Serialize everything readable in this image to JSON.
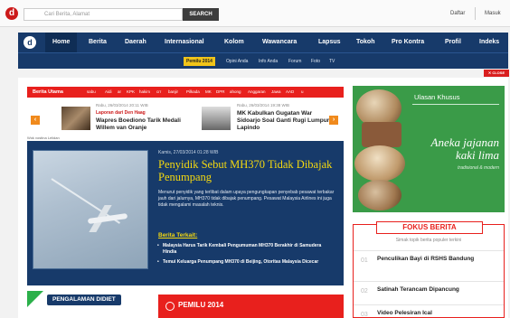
{
  "topbar": {
    "logo_letter": "d",
    "search_placeholder": "Cari Berita, Alamat",
    "search_button": "SEARCH",
    "daftar": "Daftar",
    "masuk": "Masuk"
  },
  "nav": {
    "logo_letter": "d",
    "items": [
      "Home",
      "Berita",
      "Daerah",
      "Internasional",
      "Kolom",
      "Wawancara",
      "Lapsus",
      "Tokoh",
      "Pro Kontra",
      "Profil",
      "Indeks"
    ]
  },
  "subnav": {
    "items": [
      "Pemilu 2014",
      "Opini Anda",
      "Info Anda",
      "Forum",
      "Foto",
      "TV"
    ]
  },
  "close_ad": "✕ CLOSE",
  "berita_utama": {
    "label": "Berita Utama",
    "tags": [
      "sabu",
      "Aidi",
      "ar",
      "KPK",
      "hakim",
      "crr",
      "banjir",
      "Pilkada",
      "MK",
      "DPR",
      "ahong",
      "Anggaran",
      "Jawa",
      "AAD",
      "u"
    ]
  },
  "carousel": {
    "items": [
      {
        "date": "Rabu, 26/03/2014 20:11 WIB",
        "category": "Laporan dari Den Haag",
        "title": "Wapres Boediono Tarik Medali Willem van Oranje"
      },
      {
        "date": "Rabu, 26/03/2014 19:38 WIB",
        "category": "",
        "title": "MK Kabulkan Gugatan War Sidoarjo Soal Ganti Rugi Lumpur Lapindo"
      }
    ],
    "cut_text": "Wok vostina Lelidan"
  },
  "featured": {
    "date": "Kamis, 27/03/2014 01:28 WIB",
    "title": "Penyidik Sebut MH370 Tidak Dibajak Penumpang",
    "body": "Menurut penyidik yang terlibat dalam upaya pengungkapan penyebab pesawat terbakar jauh dari jalurnya, MH370 tidak dibajak penumpang. Pesawat Malaysia Airlines ini juga tidak mengalami masalah teknis.",
    "related_label": "Berita Terkait:",
    "related": [
      "Malaysia Harus Tarik Kembali Pengumuman MH370 Berakhir di Samudera Hindia",
      "Temui Keluarga Penumpang MH370 di Beijing, Otoritas Malaysia Dicecar"
    ]
  },
  "pengalaman": {
    "label": "PENGALAMAN DIDIET"
  },
  "pemilu": {
    "label": "PEMILU 2014"
  },
  "ad": {
    "title": "Ulasan Khusus",
    "headline": "Aneka jajanan kaki lima",
    "sub": "tradisional & modern"
  },
  "fokus": {
    "title": "FOKUS BERITA",
    "subtitle": "Simak topik berita populer terkini",
    "items": [
      {
        "num": "01",
        "text": "Penculikan Bayi di RSHS Bandung"
      },
      {
        "num": "02",
        "text": "Satinah Terancam Dipancung"
      },
      {
        "num": "03",
        "text": "Video Pelesiran Ical"
      }
    ]
  },
  "colors": {
    "nav_blue": "#173a6a",
    "accent_red": "#e8201d",
    "title_yellow": "#f5d90f",
    "ad_green": "#3a9b48"
  }
}
